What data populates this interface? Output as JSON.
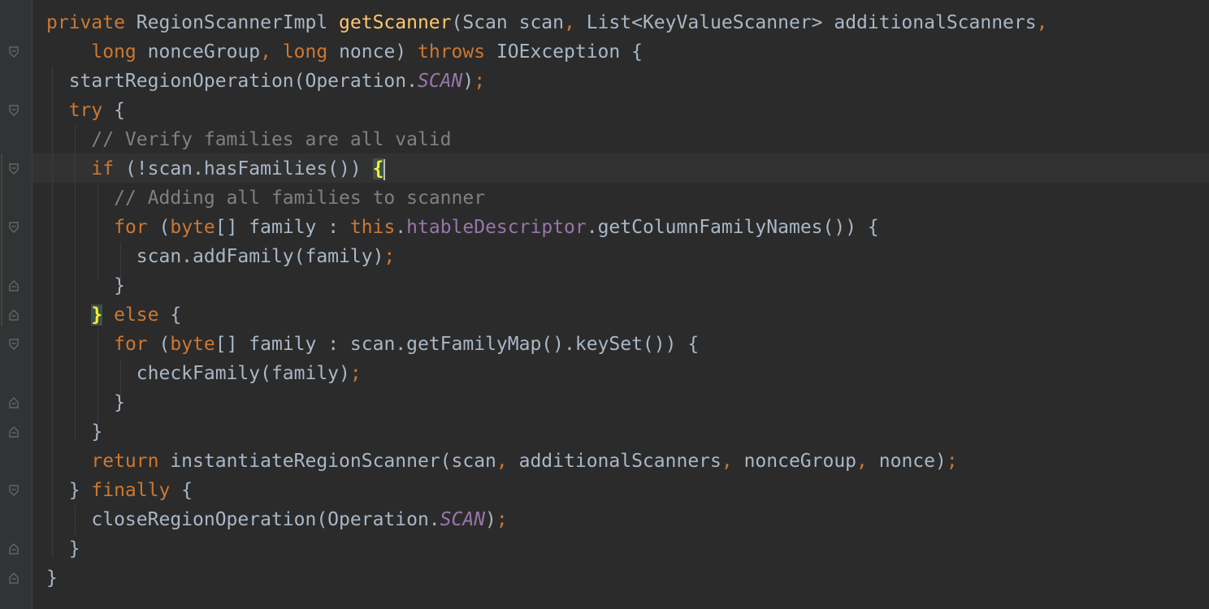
{
  "editor": {
    "language": "java",
    "colors": {
      "background": "#2b2b2b",
      "gutter": "#313335",
      "current_line": "#323232",
      "keyword": "#cc7832",
      "method_declaration": "#ffc66d",
      "comment": "#808080",
      "field": "#9876aa",
      "plain": "#a9b7c6",
      "brace_match": "#ffef28",
      "brace_match_bg": "#3b514d"
    },
    "fold_icons": [
      "fold-open-icon",
      "fold-close-icon"
    ],
    "lines": [
      [
        [
          "kw",
          "private "
        ],
        [
          "",
          "RegionScannerImpl "
        ],
        [
          "fn",
          "getScanner"
        ],
        [
          "",
          "(Scan scan"
        ],
        [
          "kw",
          ", "
        ],
        [
          "",
          "List<KeyValueScanner> additionalScanners"
        ],
        [
          "kw",
          ","
        ]
      ],
      [
        [
          "",
          "    "
        ],
        [
          "kw",
          "long "
        ],
        [
          "",
          "nonceGroup"
        ],
        [
          "kw",
          ", long "
        ],
        [
          "",
          "nonce) "
        ],
        [
          "kw",
          "throws "
        ],
        [
          "",
          "IOException {"
        ]
      ],
      [
        [
          "",
          "  startRegionOperation(Operation."
        ],
        [
          "st",
          "SCAN"
        ],
        [
          "",
          ")"
        ],
        [
          "kw",
          ";"
        ]
      ],
      [
        [
          "",
          "  "
        ],
        [
          "kw",
          "try "
        ],
        [
          "",
          "{"
        ]
      ],
      [
        [
          "",
          "    "
        ],
        [
          "cm",
          "// Verify families are all valid"
        ]
      ],
      [
        [
          "",
          "    "
        ],
        [
          "kw",
          "if "
        ],
        [
          "",
          "(!scan.hasFamilies()) "
        ],
        [
          "brace",
          "{"
        ]
      ],
      [
        [
          "",
          "      "
        ],
        [
          "cm",
          "// Adding all families to scanner"
        ]
      ],
      [
        [
          "",
          "      "
        ],
        [
          "kw",
          "for "
        ],
        [
          "",
          "("
        ],
        [
          "kw",
          "byte"
        ],
        [
          "",
          "[] family : "
        ],
        [
          "kw",
          "this"
        ],
        [
          "",
          "."
        ],
        [
          "fld",
          "htableDescriptor"
        ],
        [
          "",
          ".getColumnFamilyNames()) {"
        ]
      ],
      [
        [
          "",
          "        scan.addFamily(family)"
        ],
        [
          "kw",
          ";"
        ]
      ],
      [
        [
          "",
          "      }"
        ]
      ],
      [
        [
          "",
          "    "
        ],
        [
          "brace",
          "}"
        ],
        [
          "",
          ""
        ],
        [
          "kw",
          " else "
        ],
        [
          "",
          "{"
        ]
      ],
      [
        [
          "",
          "      "
        ],
        [
          "kw",
          "for "
        ],
        [
          "",
          "("
        ],
        [
          "kw",
          "byte"
        ],
        [
          "",
          "[] family : scan.getFamilyMap().keySet()) {"
        ]
      ],
      [
        [
          "",
          "        checkFamily(family)"
        ],
        [
          "kw",
          ";"
        ]
      ],
      [
        [
          "",
          "      }"
        ]
      ],
      [
        [
          "",
          "    }"
        ]
      ],
      [
        [
          "",
          "    "
        ],
        [
          "kw",
          "return "
        ],
        [
          "",
          "instantiateRegionScanner(scan"
        ],
        [
          "kw",
          ", "
        ],
        [
          "",
          "additionalScanners"
        ],
        [
          "kw",
          ", "
        ],
        [
          "",
          "nonceGroup"
        ],
        [
          "kw",
          ", "
        ],
        [
          "",
          "nonce)"
        ],
        [
          "kw",
          ";"
        ]
      ],
      [
        [
          "",
          "  } "
        ],
        [
          "kw",
          "finally "
        ],
        [
          "",
          "{"
        ]
      ],
      [
        [
          "",
          "    closeRegionOperation(Operation."
        ],
        [
          "st",
          "SCAN"
        ],
        [
          "",
          ")"
        ],
        [
          "kw",
          ";"
        ]
      ],
      [
        [
          "",
          "  }"
        ]
      ],
      [
        [
          "",
          "}"
        ]
      ]
    ]
  }
}
